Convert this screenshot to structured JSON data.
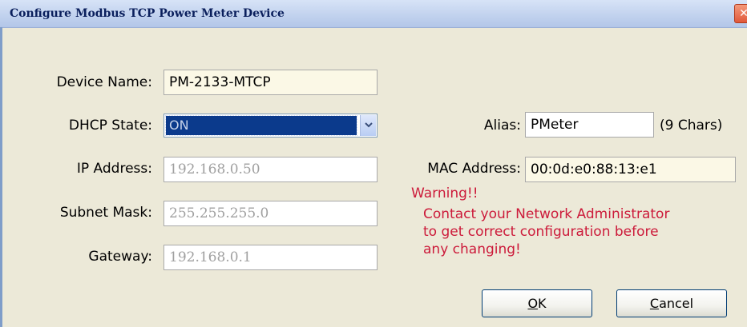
{
  "window": {
    "title": "Configure Modbus TCP Power Meter Device",
    "close_glyph": "✕"
  },
  "form": {
    "device_name": {
      "label": "Device Name:",
      "value": "PM-2133-MTCP"
    },
    "dhcp_state": {
      "label": "DHCP State:",
      "value": "ON"
    },
    "ip_address": {
      "label": "IP Address:",
      "value": "192.168.0.50"
    },
    "subnet_mask": {
      "label": "Subnet Mask:",
      "value": "255.255.255.0"
    },
    "gateway": {
      "label": "Gateway:",
      "value": "192.168.0.1"
    },
    "alias": {
      "label": "Alias:",
      "value": "PMeter",
      "hint": "(9 Chars)"
    },
    "mac_address": {
      "label": "MAC Address:",
      "value": "00:0d:e0:88:13:e1"
    }
  },
  "warning": {
    "title": "Warning!!",
    "lines": [
      "Contact your Network Administrator",
      "to get correct configuration before",
      "any changing!"
    ]
  },
  "buttons": {
    "ok": {
      "accel": "O",
      "rest": "K"
    },
    "cancel": {
      "accel": "C",
      "rest": "ancel"
    }
  },
  "colors": {
    "warning": "#cc1a3a",
    "selection": "#0b3a8c",
    "readonly_bg": "#fbf8e6"
  }
}
